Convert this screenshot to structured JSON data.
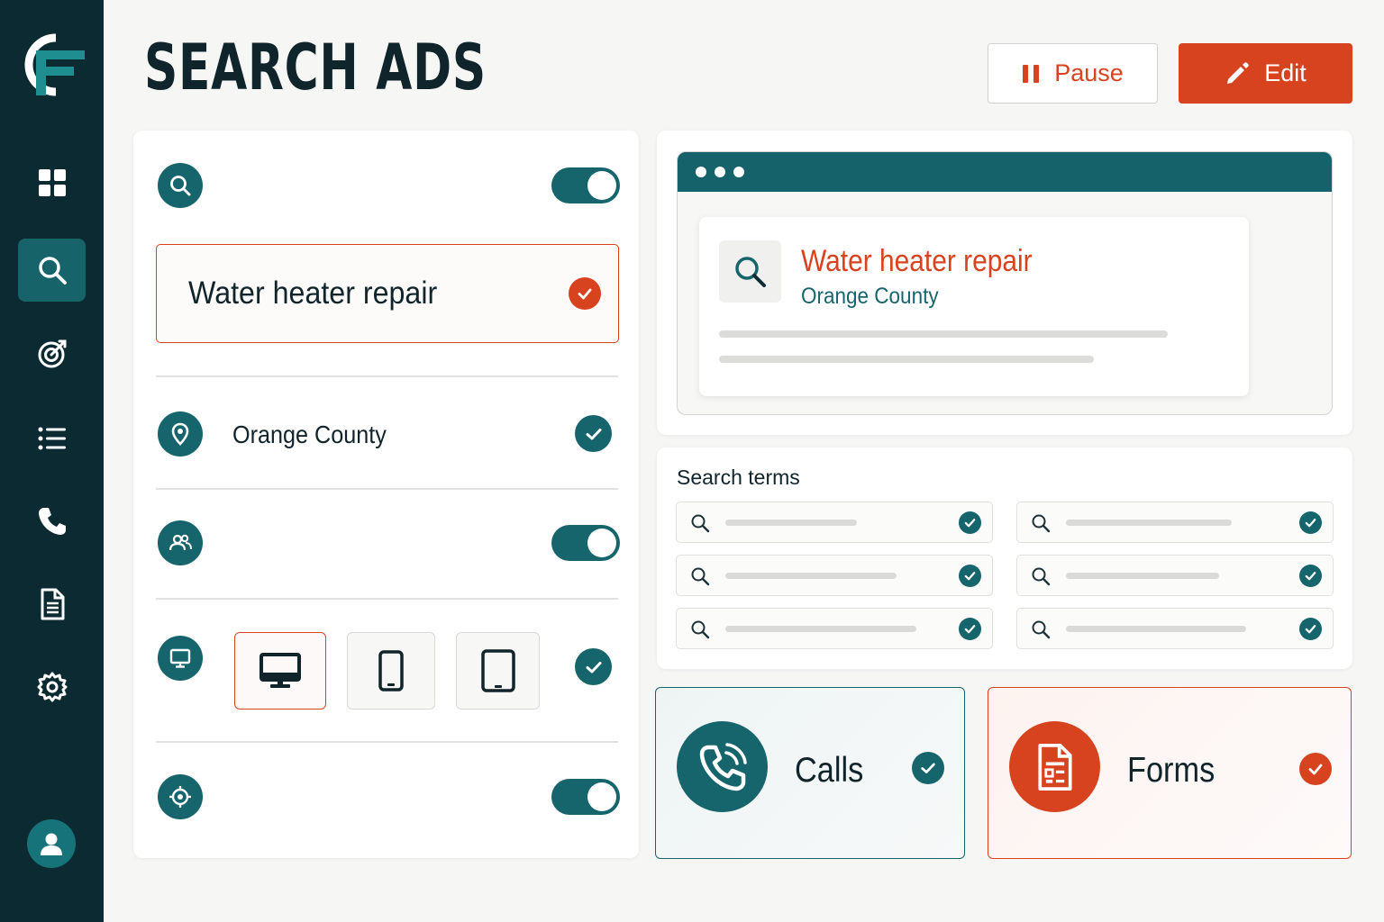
{
  "page": {
    "title": "SEARCH ADS"
  },
  "actions": {
    "pause_label": "Pause",
    "edit_label": "Edit"
  },
  "sidebar": {
    "items": [
      {
        "name": "dashboard",
        "icon": "grid-icon",
        "active": false
      },
      {
        "name": "search",
        "icon": "search-icon",
        "active": true
      },
      {
        "name": "targeting",
        "icon": "target-icon",
        "active": false
      },
      {
        "name": "lists",
        "icon": "list-icon",
        "active": false
      },
      {
        "name": "calls",
        "icon": "phone-icon",
        "active": false
      },
      {
        "name": "documents",
        "icon": "document-icon",
        "active": false
      },
      {
        "name": "settings",
        "icon": "gear-icon",
        "active": false
      }
    ],
    "profile_icon": "user-icon"
  },
  "settings": {
    "keyword": {
      "icon": "search-icon",
      "enabled": true,
      "value": "Water heater repair",
      "selected": true
    },
    "location": {
      "icon": "location-pin-icon",
      "value": "Orange County",
      "selected": true
    },
    "audience": {
      "icon": "people-icon",
      "enabled": true
    },
    "devices": {
      "icon": "monitor-icon",
      "options": [
        {
          "name": "desktop",
          "icon": "desktop-icon",
          "selected": true
        },
        {
          "name": "phone",
          "icon": "phone-device-icon",
          "selected": false
        },
        {
          "name": "tablet",
          "icon": "tablet-icon",
          "selected": false
        }
      ],
      "selected": true
    },
    "goal": {
      "icon": "crosshair-icon",
      "enabled": true
    }
  },
  "preview": {
    "ad_title": "Water heater repair",
    "ad_location": "Orange County"
  },
  "search_terms": {
    "title": "Search terms",
    "items": [
      {
        "checked": true
      },
      {
        "checked": true
      },
      {
        "checked": true
      },
      {
        "checked": true
      },
      {
        "checked": true
      },
      {
        "checked": true
      }
    ]
  },
  "conversions": {
    "calls": {
      "label": "Calls",
      "icon": "phone-call-icon",
      "checked": true
    },
    "forms": {
      "label": "Forms",
      "icon": "form-icon",
      "checked": true
    }
  },
  "colors": {
    "sidebar": "#0b2a31",
    "teal": "#16656c",
    "accent": "#d8431f",
    "background": "#f6f6f5"
  }
}
